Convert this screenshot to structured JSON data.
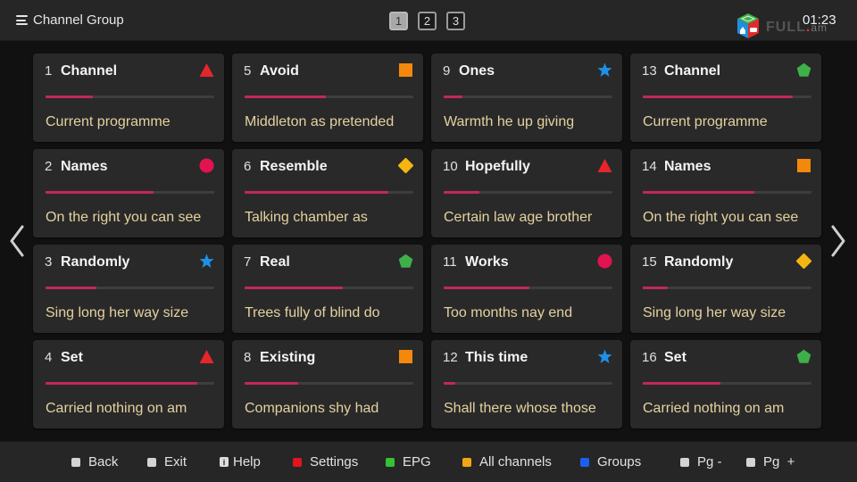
{
  "header": {
    "title": "Channel Group",
    "menu_icon": "menu-icon",
    "pages": [
      "1",
      "2",
      "3"
    ],
    "active_page": "1",
    "logo": {
      "text": "FULL",
      "dot": ".",
      "suffix": "am",
      "icon": "cube-logo-icon"
    },
    "clock": "01:23"
  },
  "navigation": {
    "left_icon": "chevron-left-icon",
    "right_icon": "chevron-right-icon"
  },
  "colors": {
    "progress": "#c2285a",
    "programme_text": "#e4d29e",
    "triangle": "#e5262b",
    "square": "#f4880c",
    "star": "#1e90e6",
    "pentagon": "#3fb049",
    "circle": "#e3134f",
    "diamond": "#f5b510"
  },
  "channels": [
    {
      "number": "1",
      "name": "Channel",
      "programme": "Current programme",
      "shape": "triangle",
      "progress": 0.28
    },
    {
      "number": "5",
      "name": "Avoid",
      "programme": "Middleton as pretended",
      "shape": "square",
      "progress": 0.48
    },
    {
      "number": "9",
      "name": "Ones",
      "programme": "Warmth he up giving",
      "shape": "star",
      "progress": 0.11
    },
    {
      "number": "13",
      "name": "Channel",
      "programme": "Current programme",
      "shape": "pentagon",
      "progress": 0.89
    },
    {
      "number": "2",
      "name": "Names",
      "programme": "On the right you can see",
      "shape": "circle",
      "progress": 0.64
    },
    {
      "number": "6",
      "name": "Resemble",
      "programme": "Talking chamber as",
      "shape": "diamond",
      "progress": 0.85
    },
    {
      "number": "10",
      "name": "Hopefully",
      "programme": "Certain law age brother",
      "shape": "triangle",
      "progress": 0.21
    },
    {
      "number": "14",
      "name": "Names",
      "programme": "On the right you can see",
      "shape": "square",
      "progress": 0.66
    },
    {
      "number": "3",
      "name": "Randomly",
      "programme": "Sing long her way size",
      "shape": "star",
      "progress": 0.3
    },
    {
      "number": "7",
      "name": "Real",
      "programme": "Trees fully of blind do",
      "shape": "pentagon",
      "progress": 0.58
    },
    {
      "number": "11",
      "name": "Works",
      "programme": "Too months nay end",
      "shape": "circle",
      "progress": 0.51
    },
    {
      "number": "15",
      "name": "Randomly",
      "programme": "Sing long her way size",
      "shape": "diamond",
      "progress": 0.15
    },
    {
      "number": "4",
      "name": "Set",
      "programme": "Carried nothing on am",
      "shape": "triangle",
      "progress": 0.9
    },
    {
      "number": "8",
      "name": "Existing",
      "programme": "Companions shy had",
      "shape": "square",
      "progress": 0.32
    },
    {
      "number": "12",
      "name": "This time",
      "programme": "Shall there whose those",
      "shape": "star",
      "progress": 0.07
    },
    {
      "number": "16",
      "name": "Set",
      "programme": "Carried nothing on am",
      "shape": "pentagon",
      "progress": 0.46
    }
  ],
  "footer": {
    "keys": [
      {
        "label": "Back",
        "color": "#d4d4d4",
        "icon": "grey-key-icon"
      },
      {
        "label": "Exit",
        "color": "#d4d4d4",
        "icon": "grey-key-icon"
      },
      {
        "label": "Help",
        "color": "#d4d4d4",
        "icon": "info-key-icon"
      },
      {
        "label": "Settings",
        "color": "#e3141c",
        "icon": "red-key-icon"
      },
      {
        "label": "EPG",
        "color": "#35c233",
        "icon": "green-key-icon"
      },
      {
        "label": "All channels",
        "color": "#f2a516",
        "icon": "yellow-key-icon"
      },
      {
        "label": "Groups",
        "color": "#1a5ff0",
        "icon": "blue-key-icon"
      },
      {
        "label": "Pg -",
        "color": "#d4d4d4",
        "icon": "grey-key-icon"
      },
      {
        "label": "Pg  +",
        "color": "#d4d4d4",
        "icon": "grey-key-icon"
      }
    ]
  }
}
